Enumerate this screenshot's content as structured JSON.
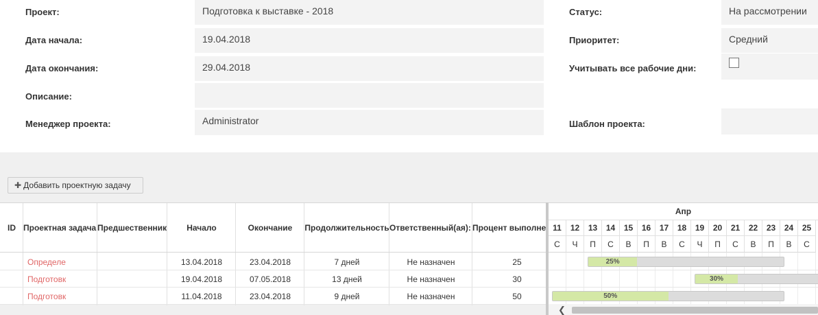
{
  "form": {
    "project_label": "Проект:",
    "project_value": "Подготовка к выставке - 2018",
    "start_label": "Дата начала:",
    "start_value": "19.04.2018",
    "end_label": "Дата окончания:",
    "end_value": "29.04.2018",
    "description_label": "Описание:",
    "description_value": "",
    "manager_label": "Менеджер проекта:",
    "manager_value": "Administrator",
    "status_label": "Статус:",
    "status_value": "На рассмотрении",
    "priority_label": "Приоритет:",
    "priority_value": "Средний",
    "workdays_label": "Учитывать все рабочие дни:",
    "workdays_checked": false,
    "template_label": "Шаблон проекта:",
    "template_value": ""
  },
  "toolbar": {
    "add_task_label": "Добавить проектную задачу"
  },
  "grid": {
    "columns": [
      "ID",
      "Проектная задача",
      "Предшественник",
      "Начало",
      "Окончание",
      "Продолжительность",
      "Ответственный(ая):",
      "Процент выполнения"
    ],
    "rows": [
      {
        "id": "",
        "task": "Определение",
        "predecessor": "",
        "start": "13.04.2018",
        "end": "23.04.2018",
        "duration": "7 дней",
        "assignee": "Не назначен",
        "percent": "25"
      },
      {
        "id": "",
        "task": "Подготовка",
        "predecessor": "",
        "start": "19.04.2018",
        "end": "07.05.2018",
        "duration": "13 дней",
        "assignee": "Не назначен",
        "percent": "30"
      },
      {
        "id": "",
        "task": "Подготовка",
        "predecessor": "",
        "start": "11.04.2018",
        "end": "23.04.2018",
        "duration": "9 дней",
        "assignee": "Не назначен",
        "percent": "50"
      }
    ]
  },
  "gantt": {
    "month": "Апр",
    "days": [
      "11",
      "12",
      "13",
      "14",
      "15",
      "16",
      "17",
      "18",
      "19",
      "20",
      "21",
      "22",
      "23",
      "24",
      "25"
    ],
    "weekdays": [
      "С",
      "Ч",
      "П",
      "С",
      "В",
      "П",
      "В",
      "С",
      "Ч",
      "П",
      "С",
      "В",
      "П",
      "В",
      "С"
    ],
    "first_day": 11,
    "bars": [
      {
        "start_day": 13.0,
        "end_day": 24.0,
        "progress": 0.25,
        "label": "25%"
      },
      {
        "start_day": 19.0,
        "end_day": 27.0,
        "progress": 0.3,
        "label": "30%"
      },
      {
        "start_day": 11.0,
        "end_day": 24.0,
        "progress": 0.5,
        "label": "50%"
      }
    ]
  }
}
